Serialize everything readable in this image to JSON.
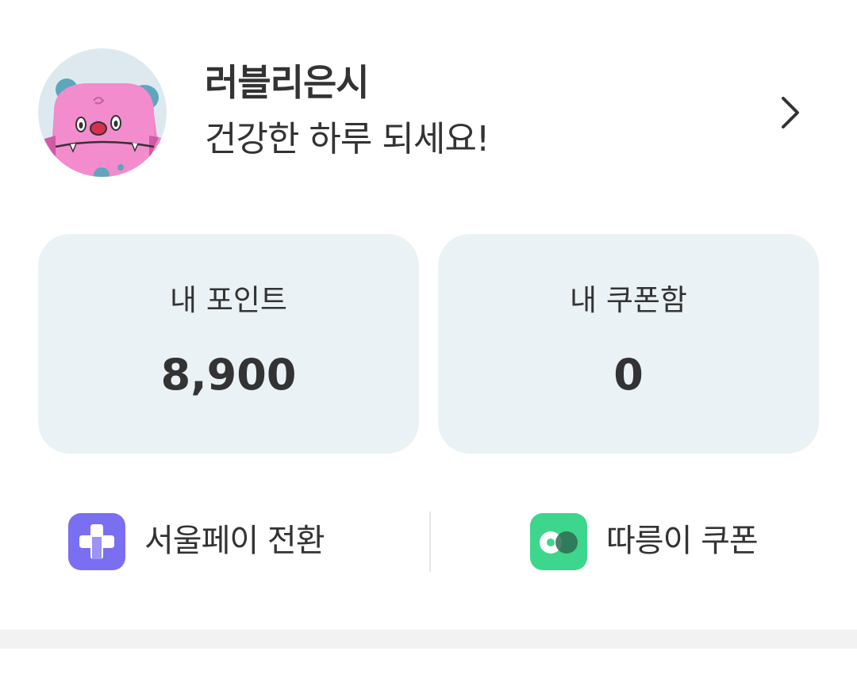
{
  "profile": {
    "nickname": "러블리은시",
    "greeting": "건강한 하루 되세요!",
    "avatar_icon": "pink-monster-avatar",
    "more_icon": "chevron-right-icon"
  },
  "cards": {
    "points": {
      "label": "내 포인트",
      "value": "8,900"
    },
    "coupons": {
      "label": "내 쿠폰함",
      "value": "0"
    }
  },
  "actions": {
    "seoulpay": {
      "label": "서울페이 전환",
      "icon": "seoulpay-plus-icon",
      "icon_color": "#7a6ff0"
    },
    "ddareungi": {
      "label": "따릉이 쿠폰",
      "icon": "ddareungi-bike-icon",
      "icon_color": "#3dd68c"
    }
  },
  "colors": {
    "card_background": "#eaf2f5",
    "text": "#333333",
    "avatar_background": "#dde9ee"
  }
}
